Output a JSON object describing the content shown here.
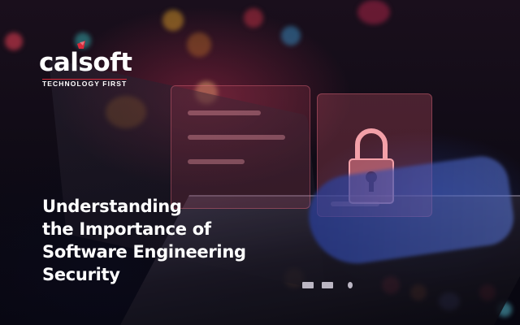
{
  "brand": {
    "logo_text": "calsoft",
    "tagline": "TECHNOLOGY FIRST",
    "accent_color": "#d72a3a"
  },
  "headline": {
    "line1": "Understanding",
    "line2": "the Importance of",
    "line3": "Software Engineering",
    "line4": "Security"
  },
  "colors": {
    "background": "#0d0a14",
    "panel_red": "#c84a5e",
    "hand_blue": "#3d5ec8"
  },
  "icons": [
    "padlock-icon",
    "logo-mark-icon"
  ]
}
